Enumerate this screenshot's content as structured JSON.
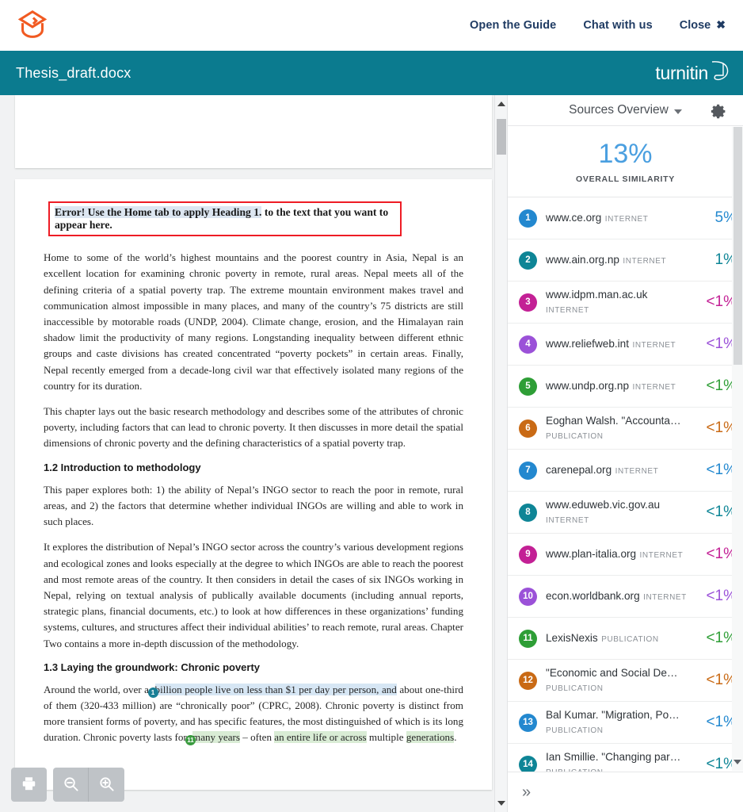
{
  "topbar": {
    "logo_icon": "graduation-cap-icon",
    "logo_color": "#F15A22",
    "links": [
      {
        "label": "Open the Guide"
      },
      {
        "label": "Chat with us"
      }
    ],
    "close_label": "Close",
    "close_icon": "close-x-icon"
  },
  "titlebar": {
    "document_name": "Thesis_draft.docx",
    "wordmark": "turnitin",
    "background": "#0b7b8f"
  },
  "viewer": {
    "error_notice": {
      "shaded_part": "Error! Use the Home tab to apply Heading 1.",
      "plain_part": " to the text that you want to appear here.",
      "border_color": "#ee1c25"
    },
    "paragraphs": [
      "Home to some of the world’s highest mountains and the poorest country in Asia, Nepal is an excellent location for examining chronic poverty in remote, rural areas. Nepal meets all of the defining criteria of a spatial poverty trap. The extreme mountain environment makes travel and communication almost impossible in many places, and many of the country’s 75 districts are still inaccessible by motorable roads (UNDP, 2004). Climate change, erosion, and the Himalayan rain shadow limit the productivity of many regions. Longstanding inequality between different ethnic groups and caste divisions has created concentrated “poverty pockets” in certain areas. Finally, Nepal recently emerged from a decade-long civil war that effectively isolated many regions of the country for its duration.",
      "This chapter lays out the basic research methodology and describes some of the attributes of chronic poverty, including factors that can lead to chronic poverty. It then discusses in more detail the spatial dimensions of chronic poverty and the defining characteristics of a spatial poverty trap."
    ],
    "heading_12": "1.2 Introduction to methodology",
    "paragraphs_12": [
      "This paper explores both: 1) the ability of Nepal’s INGO sector to reach the poor in remote, rural areas, and 2) the factors that determine whether individual INGOs are willing and able to work in such places.",
      "It explores the distribution of Nepal’s INGO sector across the country’s various development regions and ecological zones and looks especially at the degree to which INGOs are able to reach the poorest and most remote areas of the country. It then considers in detail the cases of six INGOs working in Nepal, relying on textual analysis of publically available documents (including annual reports, strategic plans, financial documents, etc.) to look at how differences in these organizations’ funding systems, cultures, and structures affect their individual abilities’ to reach remote, rural areas. Chapter Two contains a more in-depth discussion of the methodology."
    ],
    "heading_13": "1.3 Laying the groundwork: Chronic poverty",
    "highlighted_paragraph": {
      "seg_a": "Around the world, over a ",
      "marker_1": "1",
      "seg_b": "billion people live on less than $1 per day",
      "seg_c": " per person, ",
      "seg_d": "and",
      "seg_e": " about one-third of them (320-433 million) are “chronically poor” (CPRC, 2008). Chronic poverty is distinct from more transient forms of poverty, and has specific features, the most distinguished of which is its long duration. Chronic poverty lasts for ",
      "marker_11": "11",
      "seg_f": "many years",
      "seg_g": " – often ",
      "seg_h": "an entire life or across",
      "seg_i": " multiple ",
      "seg_j": "generations",
      "seg_k": "."
    },
    "tools": [
      {
        "icon": "print-icon",
        "label": "Print"
      },
      {
        "icon": "zoom-out-icon",
        "label": "Zoom out"
      },
      {
        "icon": "zoom-in-icon",
        "label": "Zoom in"
      }
    ]
  },
  "panel": {
    "header_title": "Sources Overview",
    "header_chevron_icon": "chevron-down-icon",
    "settings_icon": "gear-icon",
    "overall_percent": "13%",
    "overall_caption": "OVERALL SIMILARITY",
    "overall_color": "#4a9fe0",
    "expand_label": "»",
    "sources": [
      {
        "num": "1",
        "name": "www.ce.org",
        "type": "INTERNET",
        "pct": "5%",
        "color": "#2388cf"
      },
      {
        "num": "2",
        "name": "www.ain.org.np",
        "type": "INTERNET",
        "pct": "1%",
        "color": "#0e8596"
      },
      {
        "num": "3",
        "name": "www.idpm.man.ac.uk",
        "type": "INTERNET",
        "pct": "<1%",
        "color": "#c32095"
      },
      {
        "num": "4",
        "name": "www.reliefweb.int",
        "type": "INTERNET",
        "pct": "<1%",
        "color": "#9b51d8"
      },
      {
        "num": "5",
        "name": "www.undp.org.np",
        "type": "INTERNET",
        "pct": "<1%",
        "color": "#2e9e36"
      },
      {
        "num": "6",
        "name": "Eoghan Walsh. \"Accounta…",
        "type": "PUBLICATION",
        "pct": "<1%",
        "color": "#c96a15"
      },
      {
        "num": "7",
        "name": "carenepal.org",
        "type": "INTERNET",
        "pct": "<1%",
        "color": "#2388cf"
      },
      {
        "num": "8",
        "name": "www.eduweb.vic.gov.au",
        "type": "INTERNET",
        "pct": "<1%",
        "color": "#0e8596"
      },
      {
        "num": "9",
        "name": "www.plan-italia.org",
        "type": "INTERNET",
        "pct": "<1%",
        "color": "#c32095"
      },
      {
        "num": "10",
        "name": "econ.worldbank.org",
        "type": "INTERNET",
        "pct": "<1%",
        "color": "#9b51d8"
      },
      {
        "num": "11",
        "name": "LexisNexis",
        "type": "PUBLICATION",
        "pct": "<1%",
        "color": "#2e9e36"
      },
      {
        "num": "12",
        "name": "\"Economic and Social De…",
        "type": "PUBLICATION",
        "pct": "<1%",
        "color": "#c96a15"
      },
      {
        "num": "13",
        "name": "Bal Kumar. \"Migration, Po…",
        "type": "PUBLICATION",
        "pct": "<1%",
        "color": "#2388cf"
      },
      {
        "num": "14",
        "name": "Ian Smillie. \"Changing par…",
        "type": "PUBLICATION",
        "pct": "<1%",
        "color": "#0e8596"
      }
    ]
  }
}
